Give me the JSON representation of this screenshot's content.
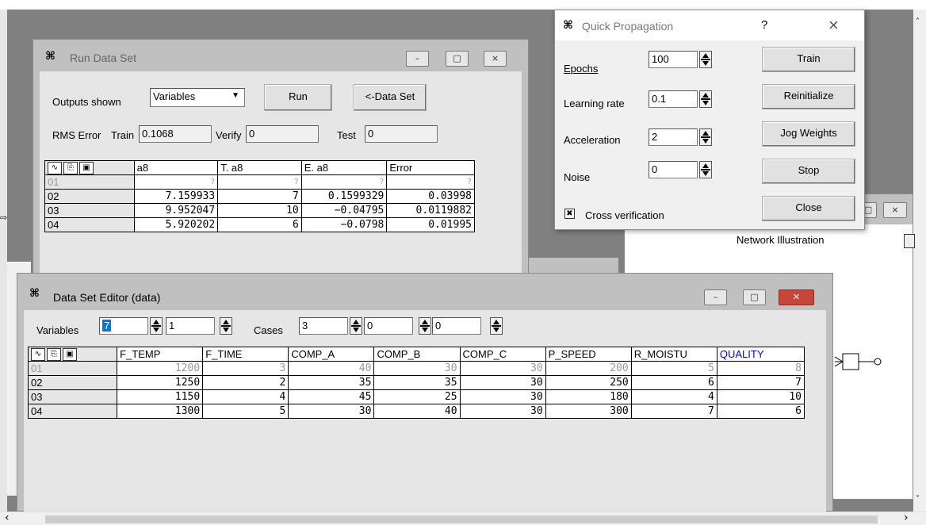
{
  "run_window": {
    "title": "Run Data Set",
    "outputs_label": "Outputs shown",
    "outputs_value": "Variables",
    "run_button": "Run",
    "dataset_button": "<-Data Set",
    "rms_label": "RMS Error",
    "train_label": "Train",
    "train_value": "0.1068",
    "verify_label": "Verify",
    "verify_value": "0",
    "test_label": "Test",
    "test_value": "0",
    "columns": [
      "a8",
      "T. a8",
      "E. a8",
      "Error"
    ],
    "rows": [
      {
        "id": "01",
        "cells": [
          "?",
          "?",
          "?",
          "?"
        ]
      },
      {
        "id": "02",
        "cells": [
          "7.159933",
          "7",
          "0.1599329",
          "0.03998"
        ]
      },
      {
        "id": "03",
        "cells": [
          "9.952047",
          "10",
          "−0.04795",
          "0.0119882"
        ]
      },
      {
        "id": "04",
        "cells": [
          "5.920202",
          "6",
          "−0.0798",
          "0.01995"
        ]
      }
    ]
  },
  "qp_window": {
    "title": "Quick Propagation",
    "help": "?",
    "close": "×",
    "epochs_label": "Epochs",
    "epochs_value": "100",
    "lr_label": "Learning rate",
    "lr_value": "0.1",
    "accel_label": "Acceleration",
    "accel_value": "2",
    "noise_label": "Noise",
    "noise_value": "0",
    "cross_label": "Cross verification",
    "cross_mark": "✖",
    "train_btn": "Train",
    "reinit_btn": "Reinitialize",
    "jog_btn": "Jog Weights",
    "stop_btn": "Stop",
    "close_btn": "Close"
  },
  "net_window": {
    "title": "Network Illustration"
  },
  "editor_window": {
    "title": "Data Set Editor (data)",
    "variables_label": "Variables",
    "variables_value": "7",
    "variables_second": "1",
    "cases_label": "Cases",
    "cases_value": "3",
    "cases_second": "0",
    "cases_third": "0",
    "columns": [
      "F_TEMP",
      "F_TIME",
      "COMP_A",
      "COMP_B",
      "COMP_C",
      "P_SPEED",
      "R_MOISTU",
      "QUALITY"
    ],
    "rows": [
      {
        "id": "01",
        "cells": [
          "1200",
          "3",
          "40",
          "30",
          "30",
          "200",
          "5",
          "8"
        ]
      },
      {
        "id": "02",
        "cells": [
          "1250",
          "2",
          "35",
          "35",
          "30",
          "250",
          "6",
          "7"
        ]
      },
      {
        "id": "03",
        "cells": [
          "1150",
          "4",
          "45",
          "25",
          "30",
          "180",
          "4",
          "10"
        ]
      },
      {
        "id": "04",
        "cells": [
          "1300",
          "5",
          "30",
          "40",
          "30",
          "300",
          "7",
          "6"
        ]
      }
    ]
  },
  "colors": {
    "window_frame": "#c0c0c0",
    "dialog_bg": "#f0f0f0",
    "close_red": "#c8453a",
    "output_column": "#0000ff"
  }
}
